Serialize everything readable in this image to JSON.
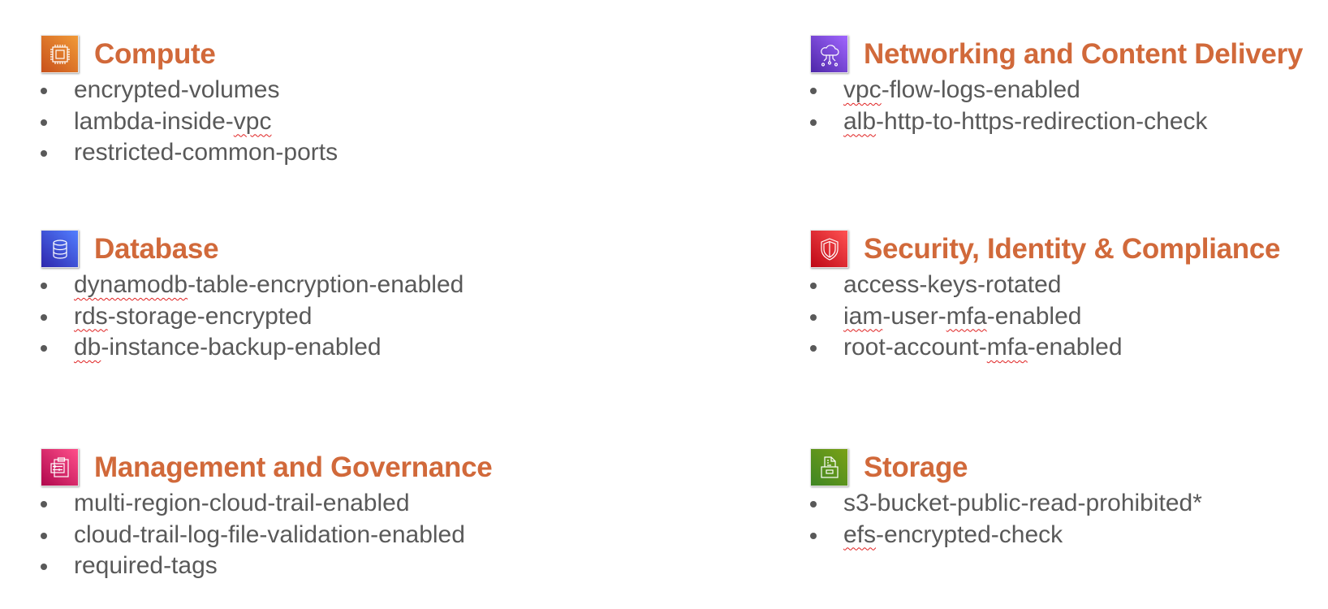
{
  "colors": {
    "heading": "#D1693A",
    "body_text": "#595959",
    "spellcheck_underline": "#e02020"
  },
  "sections": [
    {
      "id": "compute",
      "title": "Compute",
      "icon": "compute-chip-icon",
      "icon_color": "#ED7100",
      "items": [
        {
          "text": "encrypted-volumes"
        },
        {
          "pre": "lambda-inside-",
          "flagged": "vpc",
          "post": ""
        },
        {
          "text": "restricted-common-ports"
        }
      ]
    },
    {
      "id": "networking",
      "title": "Networking and Content Delivery",
      "icon": "cloud-network-icon",
      "icon_color": "#8C4FFF",
      "items": [
        {
          "pre": "",
          "flagged": "vpc",
          "post": "-flow-logs-enabled"
        },
        {
          "pre": "",
          "flagged": "alb",
          "post": "-http-to-https-redirection-check"
        }
      ]
    },
    {
      "id": "database",
      "title": "Database",
      "icon": "database-icon",
      "icon_color": "#3B48CC",
      "items": [
        {
          "pre": "",
          "flagged": "dynamodb",
          "post": "-table-encryption-enabled"
        },
        {
          "pre": "",
          "flagged": "rds",
          "post": "-storage-encrypted"
        },
        {
          "pre": "",
          "flagged": "db",
          "post": "-instance-backup-enabled"
        }
      ]
    },
    {
      "id": "security",
      "title": "Security, Identity & Compliance",
      "icon": "shield-icon",
      "icon_color": "#DD344C",
      "items": [
        {
          "text": "access-keys-rotated"
        },
        {
          "pre": "",
          "flagged": "iam",
          "post": "-user-",
          "flagged2": "mfa",
          "post2": "-enabled"
        },
        {
          "pre": "root-account-",
          "flagged": "mfa",
          "post": "-enabled"
        }
      ]
    },
    {
      "id": "management",
      "title": "Management and Governance",
      "icon": "clipboard-settings-icon",
      "icon_color": "#E7157B",
      "items": [
        {
          "text": "multi-region-cloud-trail-enabled"
        },
        {
          "text": "cloud-trail-log-file-validation-enabled"
        },
        {
          "text": "required-tags"
        }
      ]
    },
    {
      "id": "storage",
      "title": "Storage",
      "icon": "file-cabinet-icon",
      "icon_color": "#7AA116",
      "items": [
        {
          "text": "s3-bucket-public-read-prohibited*"
        },
        {
          "pre": "",
          "flagged": "efs",
          "post": "-encrypted-check"
        }
      ]
    }
  ]
}
